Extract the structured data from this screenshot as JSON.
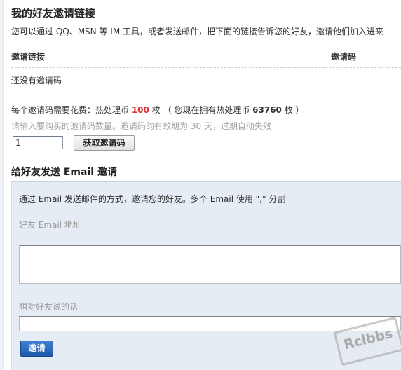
{
  "header": {
    "title": "我的好友邀请链接",
    "description": "您可以通过 QQ、MSN 等 IM 工具，或者发送邮件，把下面的链接告诉您的好友，邀请他们加入进来"
  },
  "invite_table": {
    "col_link": "邀请链接",
    "col_code": "邀请码",
    "empty_text": "还没有邀请码"
  },
  "cost": {
    "prefix": "每个邀请码需要花费：热处理币 ",
    "price": "100",
    "mid": " 枚 （ 您现在拥有热处理币 ",
    "balance": "63760",
    "suffix": " 枚 ）"
  },
  "purchase": {
    "hint": "请输入要购买的邀请码数量。邀请码的有效期为 30 天，过期自动失效",
    "quantity_value": "1",
    "get_button": "获取邀请码"
  },
  "email_invite": {
    "heading": "给好友发送 Email 邀请",
    "instructions": "通过 Email 发送邮件的方式，邀请您的好友。多个 Email 使用 \",\" 分割",
    "email_label": "好友 Email 地址",
    "email_value": "",
    "message_label": "想对好友说的话",
    "message_value": "",
    "invite_button": "邀请"
  },
  "watermark": {
    "text": "Rclbbs"
  },
  "colors": {
    "price": "#e0322d",
    "panel_bg": "#e6ecf3",
    "invite_button": "#2a66b8"
  }
}
